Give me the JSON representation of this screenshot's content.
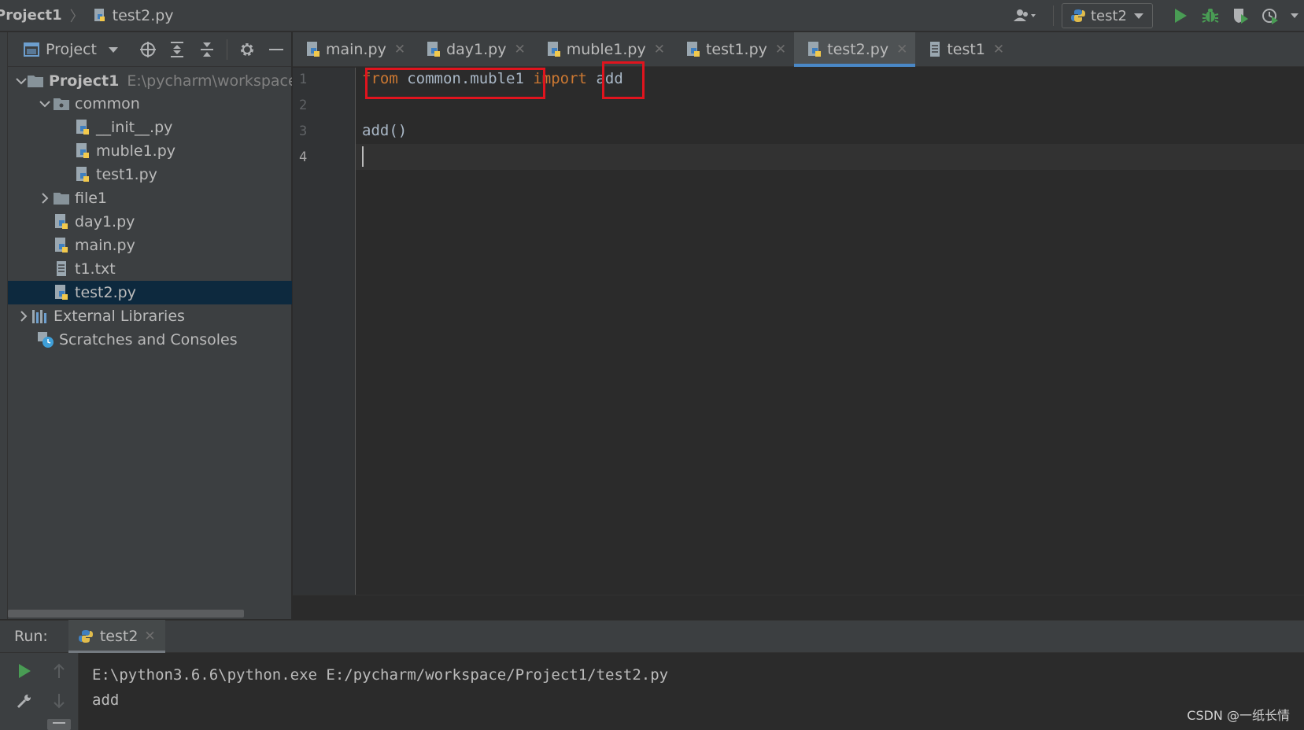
{
  "breadcrumb": {
    "project": "Project1",
    "file": "test2.py"
  },
  "run_config": {
    "label": "test2"
  },
  "project_panel": {
    "title": "Project",
    "tree": [
      {
        "label": "Project1",
        "path": "E:\\pycharm\\workspace\\P",
        "type": "project-folder",
        "expanded": true
      },
      {
        "label": "common",
        "type": "package-folder",
        "expanded": true
      },
      {
        "label": "__init__.py",
        "type": "python-file"
      },
      {
        "label": "muble1.py",
        "type": "python-file"
      },
      {
        "label": "test1.py",
        "type": "python-file"
      },
      {
        "label": "file1",
        "type": "folder",
        "expanded": false
      },
      {
        "label": "day1.py",
        "type": "python-file"
      },
      {
        "label": "main.py",
        "type": "python-file"
      },
      {
        "label": "t1.txt",
        "type": "text-file"
      },
      {
        "label": "test2.py",
        "type": "python-file",
        "selected": true
      },
      {
        "label": "External Libraries",
        "type": "libraries",
        "expanded": false
      },
      {
        "label": "Scratches and Consoles",
        "type": "scratches"
      }
    ]
  },
  "editor_tabs": [
    {
      "label": "main.py",
      "icon": "python-file-icon"
    },
    {
      "label": "day1.py",
      "icon": "python-file-icon"
    },
    {
      "label": "muble1.py",
      "icon": "python-file-icon"
    },
    {
      "label": "test1.py",
      "icon": "python-file-icon"
    },
    {
      "label": "test2.py",
      "icon": "python-file-icon",
      "active": true
    },
    {
      "label": "test1",
      "icon": "text-file-icon"
    }
  ],
  "code": {
    "line_numbers": [
      "1",
      "2",
      "3",
      "4"
    ],
    "line1": {
      "kw_from": "from",
      "module": " common.muble1 ",
      "kw_import": "import",
      "name": " add"
    },
    "line3": "add()"
  },
  "run_panel": {
    "label": "Run:",
    "tab": "test2",
    "output": [
      "E:\\python3.6.6\\python.exe E:/pycharm/workspace/Project1/test2.py",
      "add"
    ]
  },
  "watermark": "CSDN @一纸长情",
  "colors": {
    "keyword": "#cc7832",
    "identifier": "#a9b7c6",
    "highlight_box": "#e0141e",
    "selection": "#0d293e",
    "tab_underline": "#4a88c7"
  }
}
